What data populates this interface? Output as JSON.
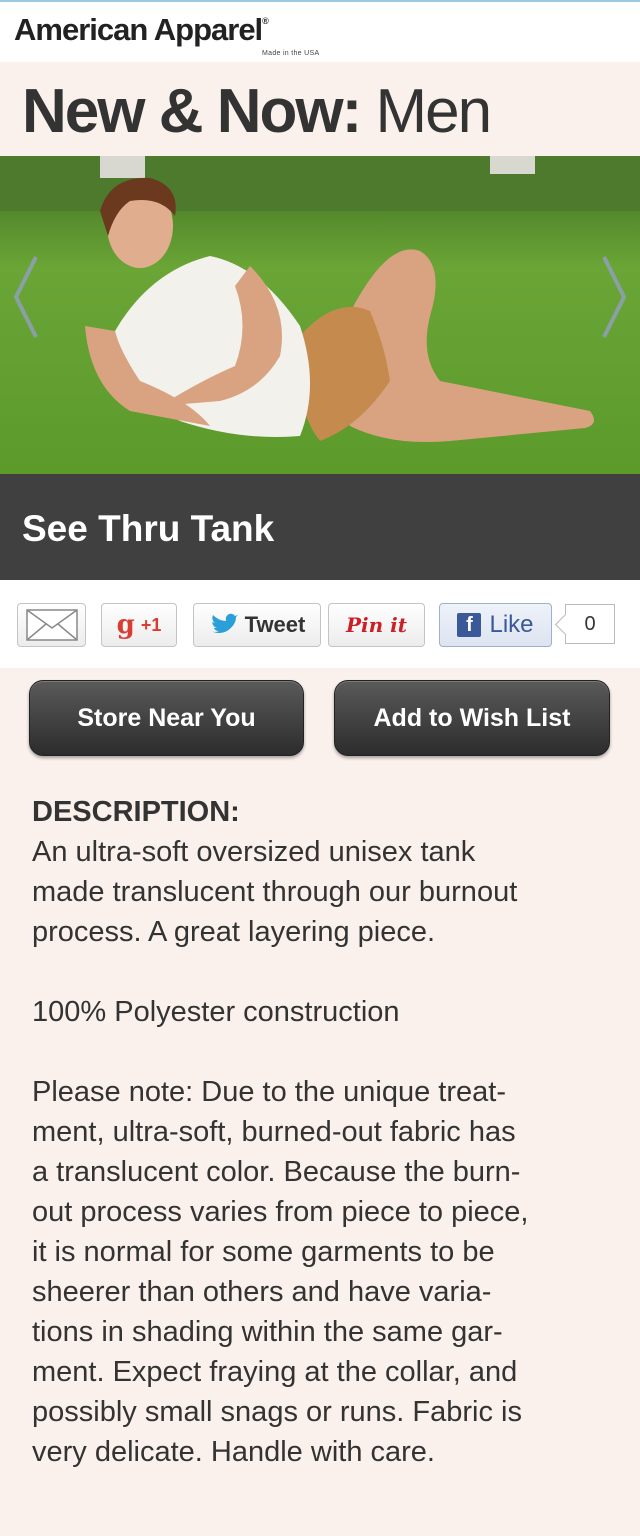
{
  "header": {
    "brand": "American Apparel",
    "brand_mark": "®",
    "tagline": "Made in the USA"
  },
  "page": {
    "title_bold": "New & Now:",
    "title_light": "Men"
  },
  "product": {
    "name": "See Thru Tank"
  },
  "social": {
    "gplus_label": "+1",
    "tweet_label": "Tweet",
    "pin_label": "Pin it",
    "like_label": "Like",
    "like_count": "0",
    "icons": [
      "email-icon",
      "google-plus-icon",
      "twitter-bird-icon",
      "pinterest-icon",
      "facebook-icon"
    ]
  },
  "actions": {
    "store_label": "Store Near You",
    "wishlist_label": "Add to Wish List"
  },
  "description": {
    "heading": "DESCRIPTION:",
    "para1": "An ultra-soft oversized unisex tank\nmade translucent through our burnout\nprocess. A great layering piece.",
    "para2": "100% Polyester construction",
    "para3": "Please note: Due to the unique treat-\nment, ultra-soft, burned-out fabric has\na translucent color. Because the burn-\nout process varies from piece to piece,\nit is normal for some garments to be\nsheerer than others and have varia-\ntions in shading within the same gar-\nment. Expect fraying at the collar, and\npossibly small snags or runs. Fabric is\nvery delicate. Handle with care."
  },
  "colors": {
    "page_bg": "#faf0ec",
    "title_bar": "#404040",
    "button_dark": "#2c2c2c",
    "grass": "#5f9a2e"
  }
}
